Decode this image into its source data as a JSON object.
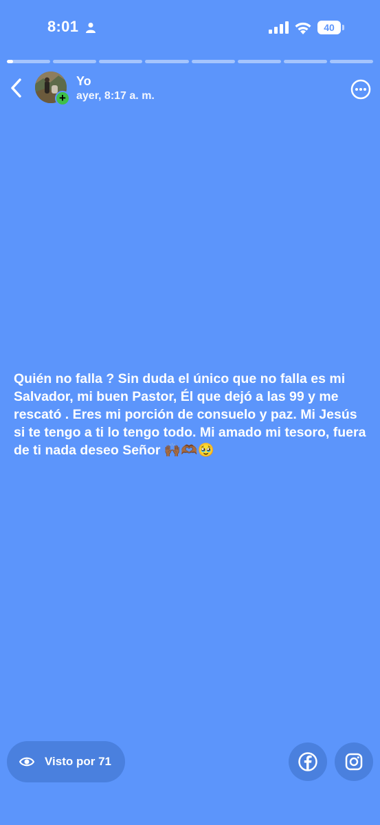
{
  "status_bar": {
    "time": "8:01",
    "battery": "40"
  },
  "story": {
    "segments": 8,
    "progress_active": 0.15,
    "author": "Yo",
    "timestamp": "ayer, 8:17 a. m.",
    "text": "Quién no falla ? Sin duda el único que no falla es mi Salvador, mi buen Pastor, Él que dejó a las 99 y me rescató . Eres mi porción de consuelo y paz. Mi Jesús si te tengo a ti lo tengo todo. Mi amado mi tesoro, fuera de ti nada deseo Señor",
    "emojis": "🙌🏾🫶🏾🥹"
  },
  "footer": {
    "views_label": "Visto por 71"
  },
  "colors": {
    "background": "#5c95fb",
    "text": "#ffffff",
    "badge": "#3fbf4a"
  },
  "icons": [
    "person-icon",
    "signal-icon",
    "wifi-icon",
    "back-icon",
    "more-icon",
    "eye-icon",
    "facebook-icon",
    "instagram-icon"
  ]
}
